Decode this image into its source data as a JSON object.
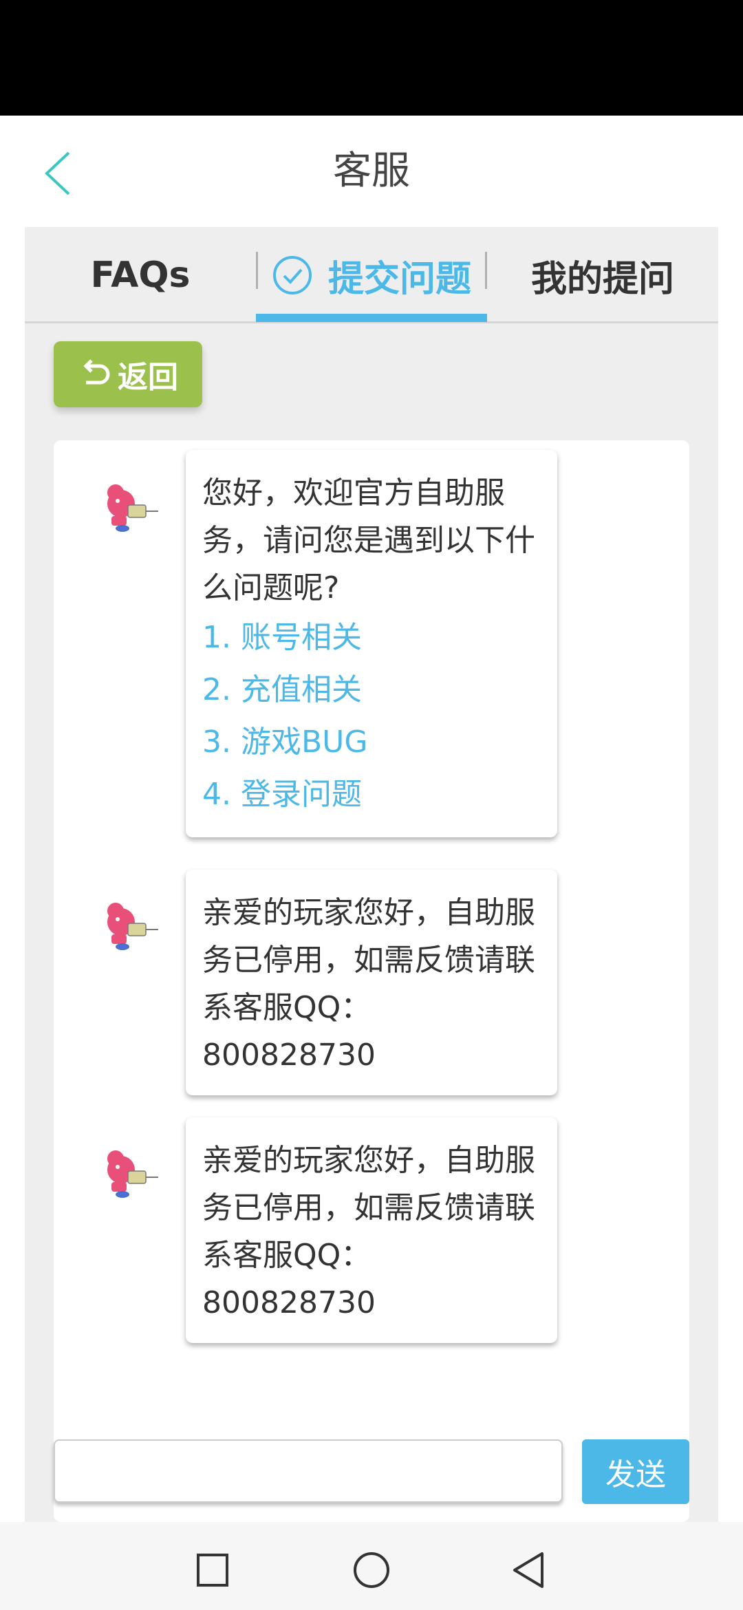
{
  "header": {
    "title": "客服"
  },
  "tabs": [
    {
      "label": "FAQs"
    },
    {
      "label": "提交问题"
    },
    {
      "label": "我的提问"
    }
  ],
  "return_button": {
    "label": "返回"
  },
  "messages": [
    {
      "text": "您好，欢迎官方自助服务，请问您是遇到以下什么问题呢?",
      "options": [
        "1. 账号相关",
        "2. 充值相关",
        "3. 游戏BUG",
        "4. 登录问题"
      ]
    },
    {
      "text": "亲爱的玩家您好，自助服务已停用，如需反馈请联系客服QQ：800828730"
    },
    {
      "text": "亲爱的玩家您好，自助服务已停用，如需反馈请联系客服QQ：800828730"
    }
  ],
  "input": {
    "value": "",
    "send_label": "发送"
  },
  "colors": {
    "accent": "#4bb8e8",
    "return_button": "#9cc04c",
    "avatar": "#e8507a"
  },
  "icons": {
    "back": "chevron-left-icon",
    "tab_active": "check-circle-icon",
    "return": "return-arrow-icon",
    "avatar": "mascot-avatar-icon",
    "nav": [
      "square-icon",
      "circle-icon",
      "triangle-back-icon"
    ]
  }
}
